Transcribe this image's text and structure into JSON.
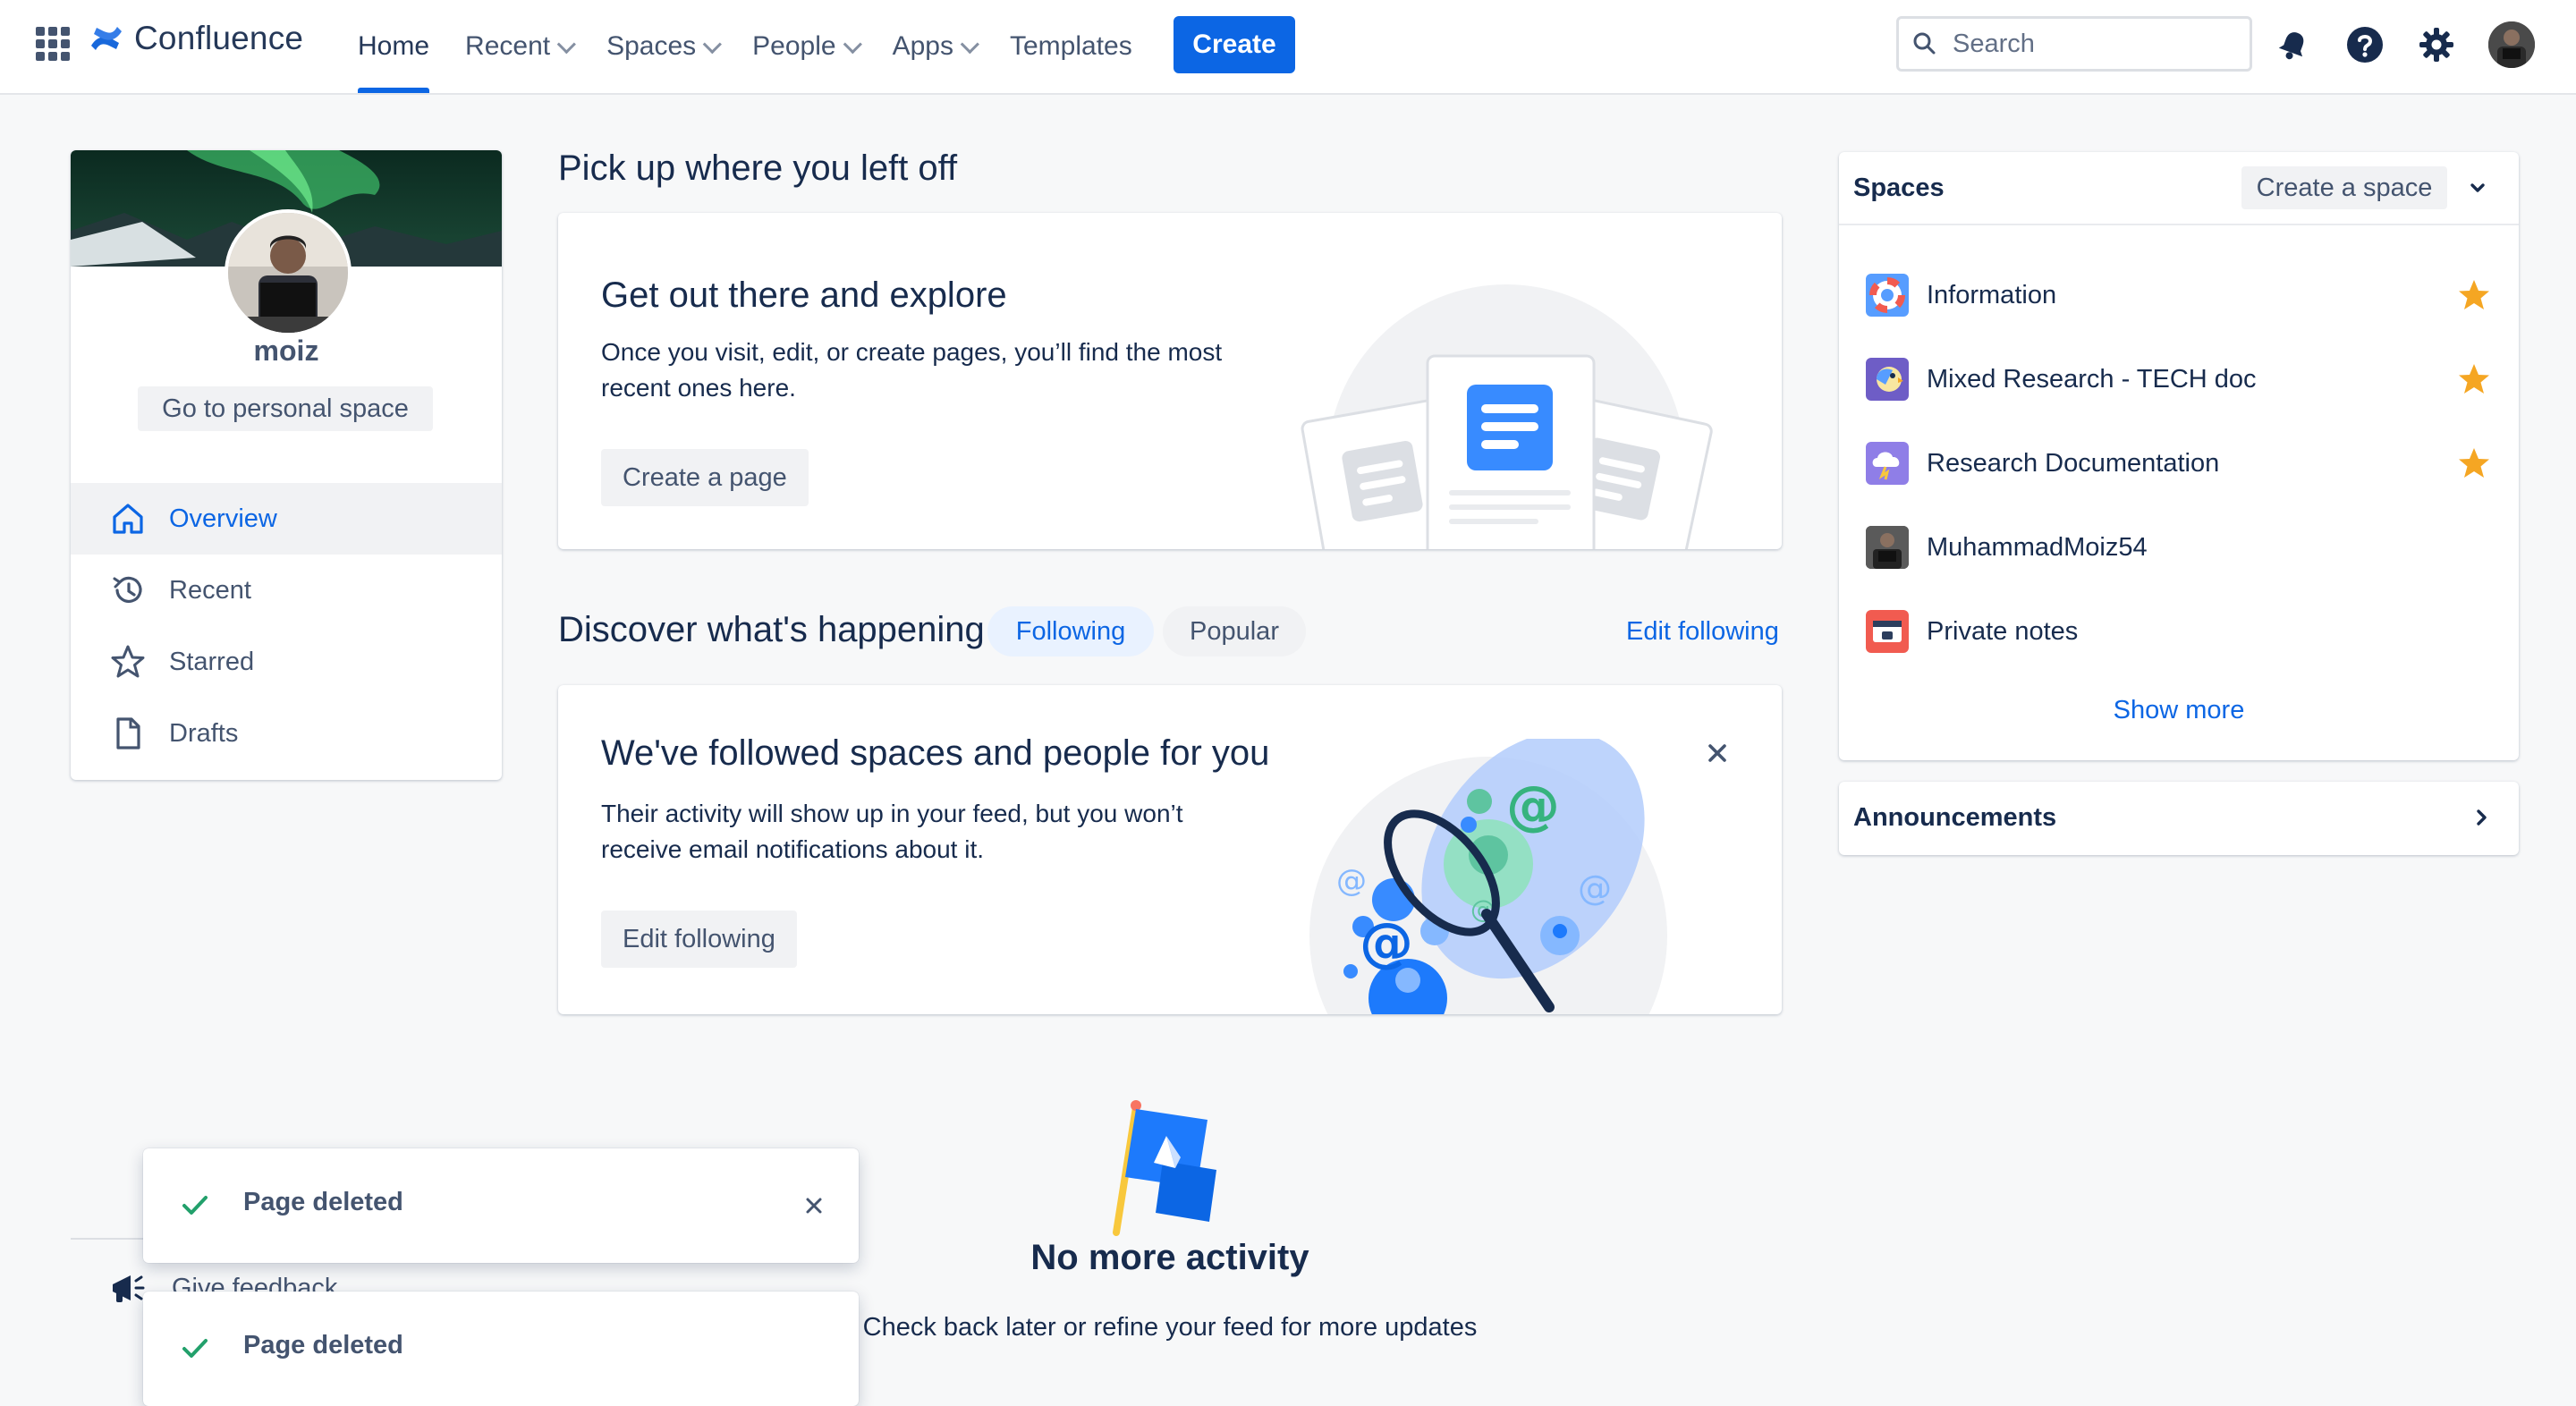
{
  "nav": {
    "logo": "Confluence",
    "items": [
      {
        "label": "Home",
        "dropdown": false,
        "active": true
      },
      {
        "label": "Recent",
        "dropdown": true
      },
      {
        "label": "Spaces",
        "dropdown": true
      },
      {
        "label": "People",
        "dropdown": true
      },
      {
        "label": "Apps",
        "dropdown": true
      },
      {
        "label": "Templates",
        "dropdown": false
      }
    ],
    "create_label": "Create",
    "search_placeholder": "Search"
  },
  "profile": {
    "name": "moiz",
    "personal_space_label": "Go to personal space",
    "menu": [
      {
        "label": "Overview",
        "icon": "home-icon",
        "active": true
      },
      {
        "label": "Recent",
        "icon": "history-icon"
      },
      {
        "label": "Starred",
        "icon": "star-icon"
      },
      {
        "label": "Drafts",
        "icon": "page-icon"
      }
    ]
  },
  "pickup": {
    "title": "Pick up where you left off",
    "card_title": "Get out there and explore",
    "card_text_1": "Once you visit, edit, or create pages, you’ll find the most",
    "card_text_2": "recent ones here.",
    "button": "Create a page"
  },
  "discover": {
    "title": "Discover what's happening",
    "tab_following": "Following",
    "tab_popular": "Popular",
    "edit_following_link": "Edit following",
    "card_title": "We've followed spaces and people for you",
    "card_text_1": "Their activity will show up in your feed, but you won’t",
    "card_text_2": "receive email notifications about it.",
    "button": "Edit following"
  },
  "empty_state": {
    "title": "No more activity",
    "text": "Check back later or refine your feed for more updates"
  },
  "spaces": {
    "title": "Spaces",
    "create_label": "Create a space",
    "items": [
      {
        "name": "Information",
        "starred": true
      },
      {
        "name": "Mixed Research - TECH doc",
        "starred": true
      },
      {
        "name": "Research Documentation",
        "starred": true
      },
      {
        "name": "MuhammadMoiz54",
        "starred": false
      },
      {
        "name": "Private notes",
        "starred": false
      }
    ],
    "show_more": "Show more"
  },
  "announcements": {
    "title": "Announcements"
  },
  "feedback": {
    "label": "Give feedback"
  },
  "flags": [
    {
      "text": "Page deleted"
    },
    {
      "text": "Page deleted"
    }
  ],
  "colors": {
    "brand_blue": "#0c66e4",
    "star_orange": "#f5a623",
    "success_green": "#22a06b"
  }
}
